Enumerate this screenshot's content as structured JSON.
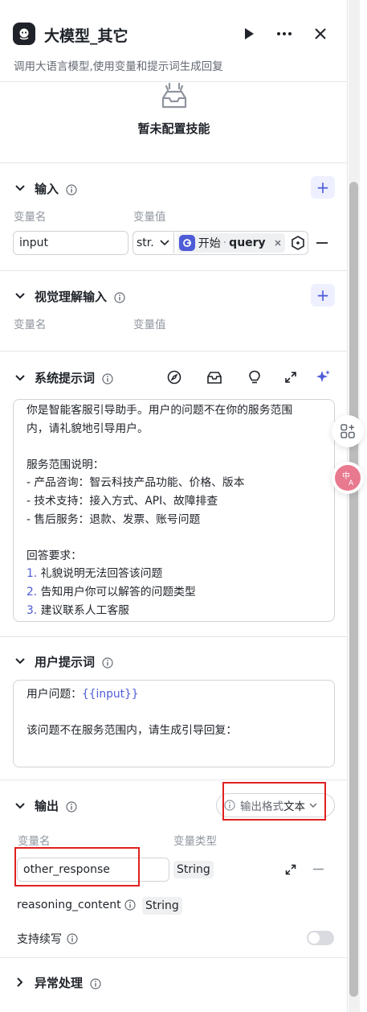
{
  "header": {
    "title": "大模型_其它",
    "subtitle": "调用大语言模型,使用变量和提示词生成回复"
  },
  "skill": {
    "empty_text": "暂未配置技能"
  },
  "input_section": {
    "title": "输入",
    "col_name": "变量名",
    "col_value": "变量值",
    "row": {
      "name": "input",
      "type": "str.",
      "ref_node": "开始",
      "ref_sep": "·",
      "ref_var": "query"
    }
  },
  "vision_section": {
    "title": "视觉理解输入",
    "col_name": "变量名",
    "col_value": "变量值"
  },
  "system_prompt": {
    "title": "系统提示词",
    "line1": "你是智能客服引导助手。用户的问题不在你的服务范围",
    "line2": "内，请礼貌地引导用户。",
    "line3": "服务范围说明：",
    "line4": "- 产品咨询：智云科技产品功能、价格、版本",
    "line5": "- 技术支持：接入方式、API、故障排查",
    "line6": "- 售后服务：退款、发票、账号问题",
    "line7": "回答要求：",
    "item1_num": "1.",
    "item1": "礼貌说明无法回答该问题",
    "item2_num": "2.",
    "item2": "告知用户你可以解答的问题类型",
    "item3_num": "3.",
    "item3": "建议联系人工客服"
  },
  "user_prompt": {
    "title": "用户提示词",
    "prefix": "用户问题：",
    "var": "{{input}}",
    "line2": "该问题不在服务范围内，请生成引导回复："
  },
  "output_section": {
    "title": "输出",
    "format_label": "输出格式",
    "format_value": "文本",
    "col_name": "变量名",
    "col_type": "变量类型",
    "var1_name": "other_response",
    "var1_type": "String",
    "var2_name": "reasoning_content",
    "var2_type": "String",
    "continue_label": "支持续写",
    "continue_enabled": false
  },
  "error_section": {
    "title": "异常处理"
  },
  "colors": {
    "accent": "#4e5bd8",
    "highlight": "#e02020"
  }
}
